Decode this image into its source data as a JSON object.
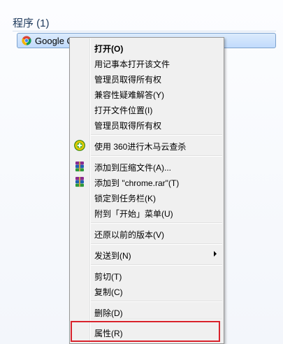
{
  "start_menu": {
    "section_header": "程序 (1)",
    "program_item": {
      "name": "Google Chrome",
      "icon": "chrome-icon"
    }
  },
  "context_menu": {
    "items": [
      {
        "label": "打开(O)",
        "bold": true
      },
      {
        "label": "用记事本打开该文件"
      },
      {
        "label": "管理员取得所有权"
      },
      {
        "label": "兼容性疑难解答(Y)"
      },
      {
        "label": "打开文件位置(I)"
      },
      {
        "label": "管理员取得所有权"
      },
      {
        "label": "使用 360进行木马云查杀",
        "icon": "360-icon"
      },
      {
        "label": "添加到压缩文件(A)...",
        "icon": "winrar-icon"
      },
      {
        "label": "添加到 \"chrome.rar\"(T)",
        "icon": "winrar-icon"
      },
      {
        "label": "锁定到任务栏(K)"
      },
      {
        "label": "附到「开始」菜单(U)"
      },
      {
        "label": "还原以前的版本(V)"
      },
      {
        "label": "发送到(N)",
        "submenu": true
      },
      {
        "label": "剪切(T)"
      },
      {
        "label": "复制(C)"
      },
      {
        "label": "删除(D)"
      },
      {
        "label": "属性(R)",
        "highlighted": true
      }
    ]
  },
  "colors": {
    "highlight_border": "#d9232c",
    "selection_fill": "#c1dbfc",
    "menu_background": "#f0f0f0"
  }
}
